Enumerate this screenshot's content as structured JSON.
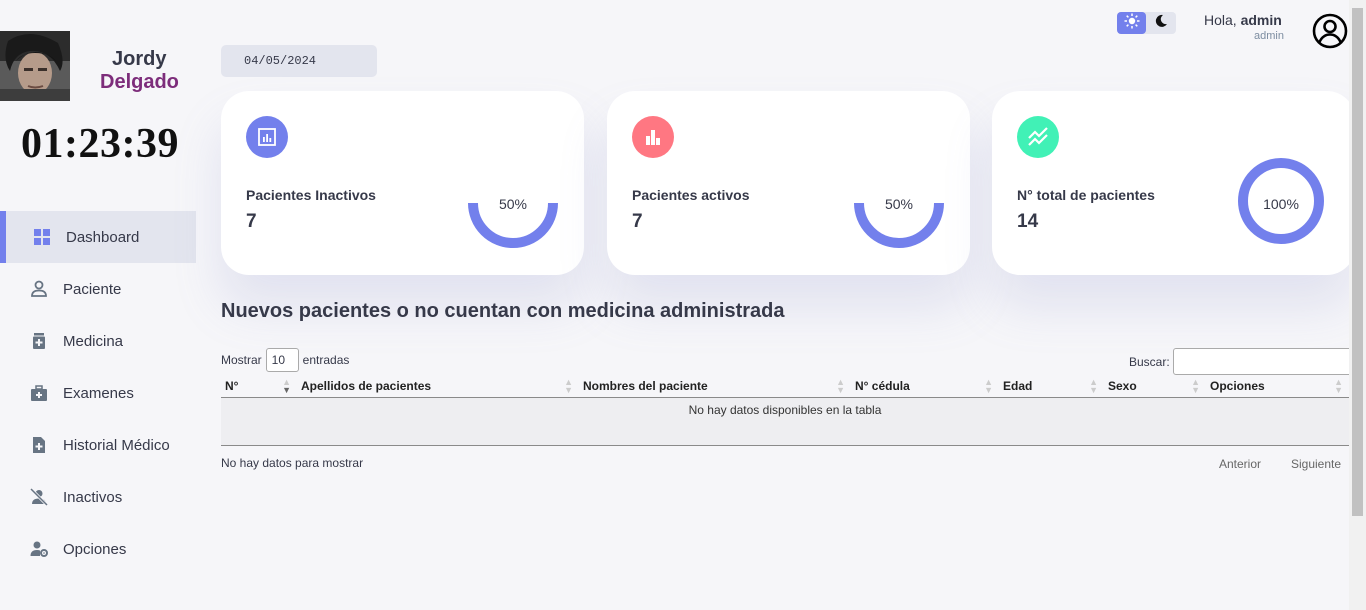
{
  "user": {
    "first_name": "Jordy",
    "last_name": "Delgado",
    "avatar_desc": "user-photo"
  },
  "clock": "01:23:39",
  "sidebar": {
    "items": [
      {
        "label": "Dashboard",
        "icon": "dashboard-icon",
        "active": true
      },
      {
        "label": "Paciente",
        "icon": "person-icon"
      },
      {
        "label": "Medicina",
        "icon": "medication-icon"
      },
      {
        "label": "Examenes",
        "icon": "medical-kit-icon"
      },
      {
        "label": "Historial Médico",
        "icon": "medical-file-icon"
      },
      {
        "label": "Inactivos",
        "icon": "person-off-icon"
      },
      {
        "label": "Opciones",
        "icon": "manage-accounts-icon"
      }
    ]
  },
  "topbar": {
    "greeting_prefix": "Hola, ",
    "username": "admin",
    "role": "admin",
    "theme": "light"
  },
  "date": "04/05/2024",
  "cards": [
    {
      "title": "Pacientes Inactivos",
      "value": "7",
      "percent_label": "50%",
      "percent": 50,
      "icon": "analytics-icon",
      "icon_color": "#7380ec"
    },
    {
      "title": "Pacientes activos",
      "value": "7",
      "percent_label": "50%",
      "percent": 50,
      "icon": "bar-chart-icon",
      "icon_color": "#ff7782"
    },
    {
      "title": "N° total de pacientes",
      "value": "14",
      "percent_label": "100%",
      "percent": 100,
      "icon": "stacked-line-chart-icon",
      "icon_color": "#41f1b6"
    }
  ],
  "colors": {
    "primary": "#7380ec",
    "danger": "#ff7782",
    "success": "#41f1b6",
    "accent_name": "#7d2d7b"
  },
  "section_title": "Nuevos pacientes o no cuentan con medicina administrada",
  "table": {
    "length_prefix": "Mostrar",
    "length_value": "10",
    "length_suffix": "entradas",
    "search_label": "Buscar:",
    "columns": [
      "N°",
      "Apellidos de pacientes",
      "Nombres del paciente",
      "N° cédula",
      "Edad",
      "Sexo",
      "Opciones"
    ],
    "empty_message": "No hay datos disponibles en la tabla",
    "info": "No hay datos para mostrar",
    "prev": "Anterior",
    "next": "Siguiente"
  }
}
